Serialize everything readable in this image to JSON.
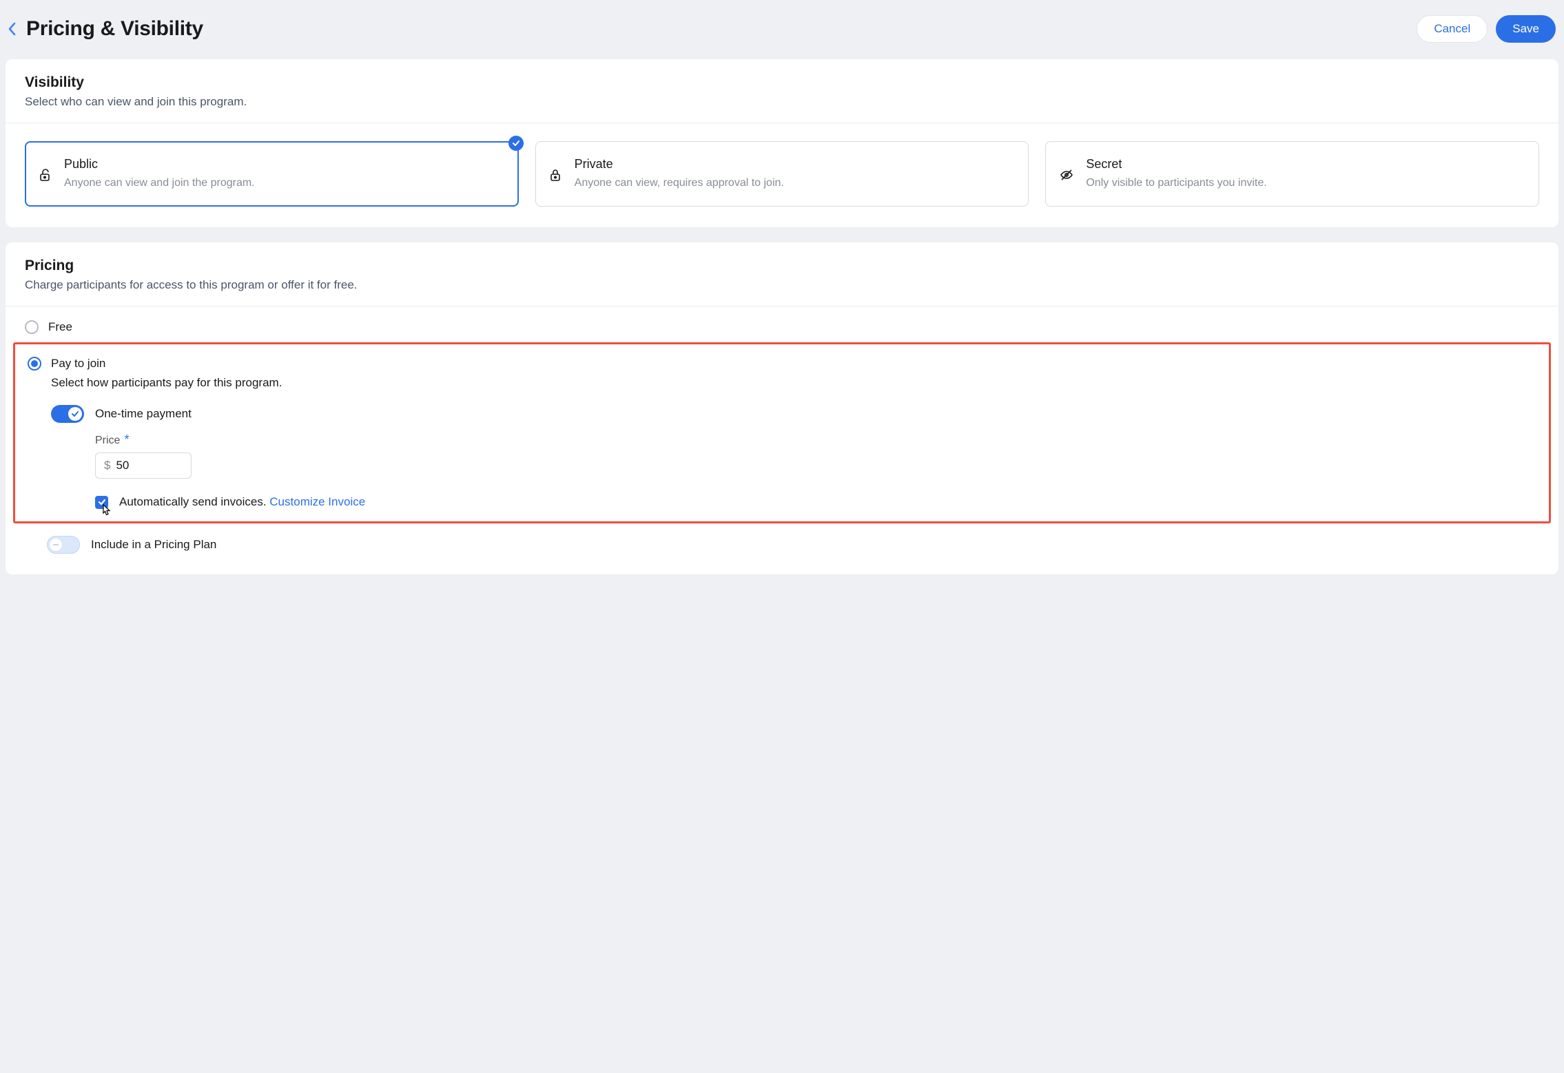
{
  "header": {
    "title": "Pricing & Visibility",
    "cancel_label": "Cancel",
    "save_label": "Save"
  },
  "visibility": {
    "title": "Visibility",
    "subtitle": "Select who can view and join this program.",
    "options": [
      {
        "title": "Public",
        "desc": "Anyone can view and join the program."
      },
      {
        "title": "Private",
        "desc": "Anyone can view, requires approval to join."
      },
      {
        "title": "Secret",
        "desc": "Only visible to participants you invite."
      }
    ]
  },
  "pricing": {
    "title": "Pricing",
    "subtitle": "Charge participants for access to this program or offer it for free.",
    "free_label": "Free",
    "pay_label": "Pay to join",
    "pay_subtitle": "Select how participants pay for this program.",
    "one_time_label": "One-time payment",
    "price_label": "Price",
    "currency_symbol": "$",
    "price_value": "50",
    "auto_invoice_label": "Automatically send invoices.",
    "customize_invoice_label": "Customize Invoice",
    "plan_label": "Include in a Pricing Plan"
  }
}
